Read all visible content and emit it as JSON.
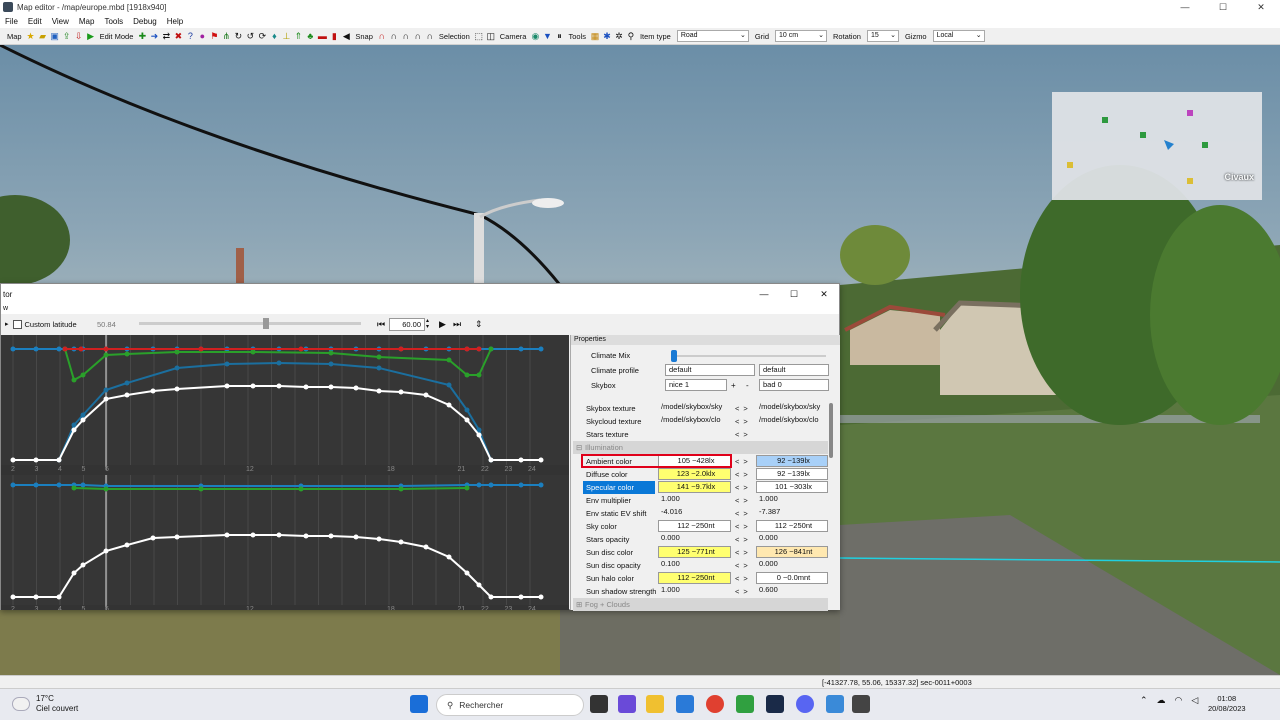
{
  "window": {
    "title": "Map editor - /map/europe.mbd [1918x940]",
    "min_label": "—",
    "max_label": "☐",
    "close_label": "✕"
  },
  "menu": [
    "File",
    "Edit",
    "View",
    "Map",
    "Tools",
    "Debug",
    "Help"
  ],
  "toolbar": {
    "map_label": "Map",
    "edit_mode_label": "Edit Mode",
    "snap_label": "Snap",
    "selection_label": "Selection",
    "camera_label": "Camera",
    "tools_label": "Tools",
    "item_type_label": "Item type",
    "item_type_value": "Road",
    "grid_label": "Grid",
    "grid_value": "10 cm",
    "rotation_label": "Rotation",
    "rotation_value": "15",
    "gizmo_label": "Gizmo",
    "gizmo_value": "Local"
  },
  "minimap": {
    "place_label": "Civaux"
  },
  "dialog": {
    "title": "tor",
    "menu_label": "w",
    "custom_latitude_label": "Custom latitude",
    "latitude_value": "50.84",
    "time_value": "60.00",
    "x_ticks": [
      "2",
      "3",
      "4",
      "5",
      "6",
      "",
      "",
      "",
      "",
      "",
      "12",
      "",
      "",
      "",
      "",
      "",
      "18",
      "",
      "",
      "21",
      "22",
      "23",
      "24"
    ],
    "props_header": "Properties",
    "climate_mix_label": "Climate Mix",
    "climate_profile_label": "Climate profile",
    "climate_profile_1": "default",
    "climate_profile_2": "default",
    "skybox_label": "Skybox",
    "skybox_1": "nice 1",
    "skybox_2": "bad 0",
    "section_illumination": "Illumination",
    "section_fog": "Fog + Clouds",
    "rows": [
      {
        "name": "Skybox texture",
        "v1": "/model/skybox/sky",
        "v2": "/model/skybox/sky"
      },
      {
        "name": "Skycloud texture",
        "v1": "/model/skybox/clo",
        "v2": "/model/skybox/clo"
      },
      {
        "name": "Stars texture",
        "v1": "",
        "v2": ""
      },
      {
        "name": "Ambient color",
        "v1": "105 ~428lx",
        "v2": "92 ~139lx"
      },
      {
        "name": "Diffuse color",
        "v1": "123 ~2.0klx",
        "v2": "92 ~139lx"
      },
      {
        "name": "Specular color",
        "v1": "141 ~9.7klx",
        "v2": "101 ~303lx"
      },
      {
        "name": "Env multiplier",
        "v1": "1.000",
        "v2": "1.000"
      },
      {
        "name": "Env static EV shift",
        "v1": "-4.016",
        "v2": "-7.387"
      },
      {
        "name": "Sky color",
        "v1": "112 ~250nt",
        "v2": "112 ~250nt"
      },
      {
        "name": "Stars opacity",
        "v1": "0.000",
        "v2": "0.000"
      },
      {
        "name": "Sun disc color",
        "v1": "125 ~771nt",
        "v2": "126 ~841nt"
      },
      {
        "name": "Sun disc opacity",
        "v1": "0.100",
        "v2": "0.000"
      },
      {
        "name": "Sun halo color",
        "v1": "112 ~250nt",
        "v2": "0 ~0.0mnt"
      },
      {
        "name": "Sun shadow strength",
        "v1": "1.000",
        "v2": "0.600"
      }
    ],
    "colors": {
      "yellow": "#ffff70",
      "blue_swatch": "#a8d0f8",
      "peach": "#ffe8b0",
      "selected": "#0a78d7",
      "red_box": "#e0001a"
    }
  },
  "status": {
    "coords": "[-41327.78, 55.06, 15337.32] sec-0011+0003"
  },
  "taskbar": {
    "temp": "17°C",
    "weather": "Ciel couvert",
    "search": "Rechercher",
    "time": "01:08",
    "date": "20/08/2023"
  }
}
